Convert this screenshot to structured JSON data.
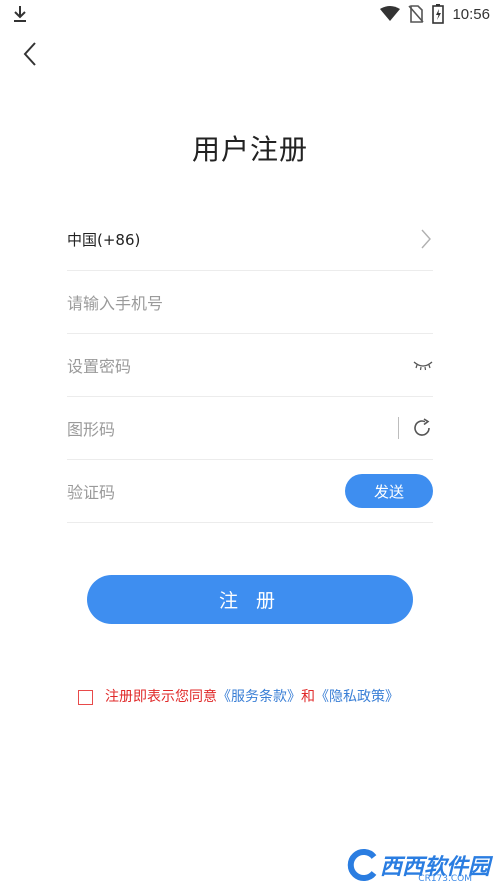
{
  "status_bar": {
    "time": "10:56",
    "icons": [
      "download-icon",
      "wifi-icon",
      "no-sim-icon",
      "battery-icon"
    ]
  },
  "header": {
    "back_icon": "chevron-left-icon",
    "title": "用户注册"
  },
  "form": {
    "country": {
      "label": "中国(+86)",
      "icon": "chevron-right-icon"
    },
    "phone": {
      "placeholder": "请输入手机号"
    },
    "password": {
      "placeholder": "设置密码",
      "icon": "eye-closed-icon"
    },
    "captcha": {
      "placeholder": "图形码",
      "icon": "refresh-icon"
    },
    "verify": {
      "placeholder": "验证码",
      "send_label": "发送"
    }
  },
  "register_label": "注 册",
  "agreement": {
    "text": "注册即表示您同意",
    "terms_link": "《服务条款》",
    "and": "和",
    "privacy_link": "《隐私政策》"
  },
  "watermark": {
    "text": "西西软件园",
    "sub": "CR173.COM"
  },
  "colors": {
    "primary": "#3e8ef0",
    "agree_text": "#e02a2a",
    "link": "#3a7fd6"
  }
}
